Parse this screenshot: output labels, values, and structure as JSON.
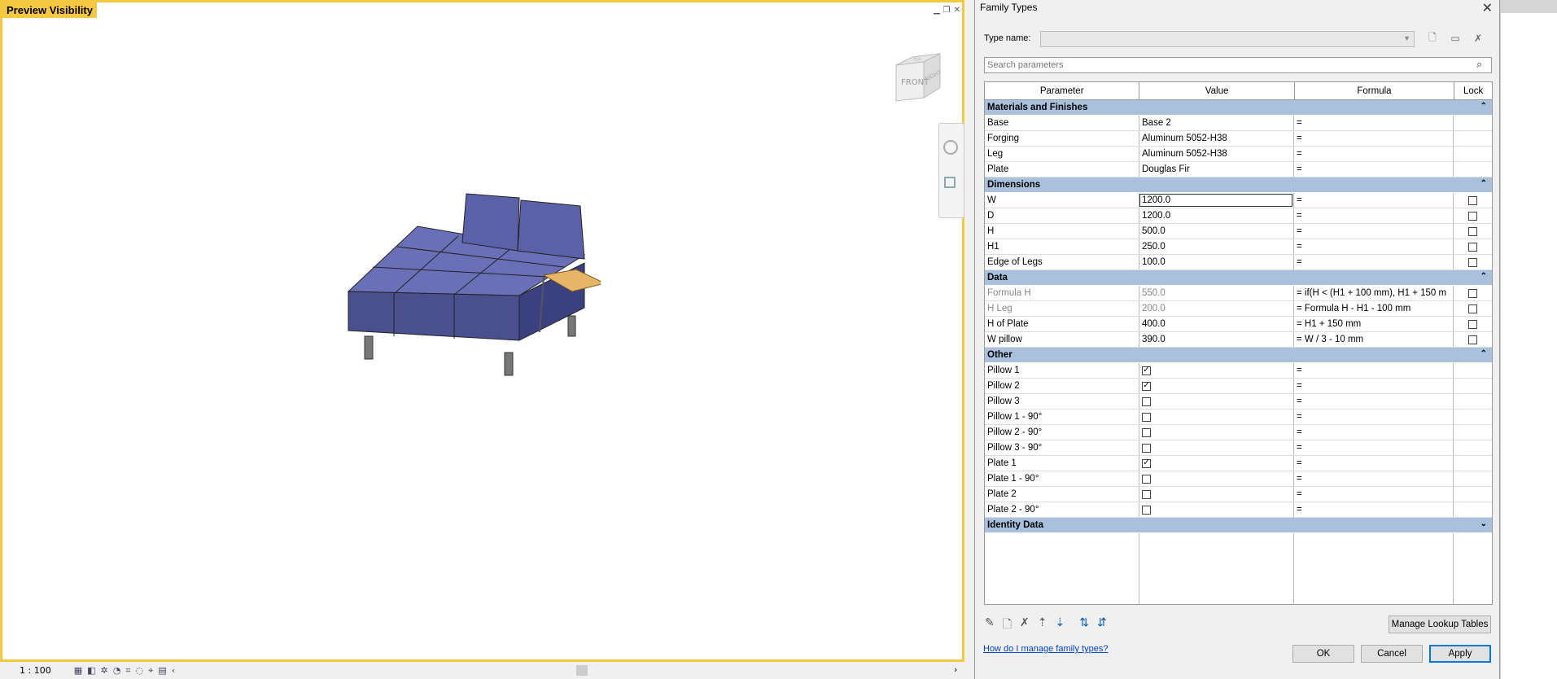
{
  "viewport": {
    "title": "Preview Visibility",
    "scale": "1 : 100",
    "viewcube_face": "FRONT",
    "viewcube_side": "RIGHT",
    "viewcube_top": "TOP"
  },
  "dialog": {
    "title": "Family Types",
    "type_name_label": "Type name:",
    "type_name_value": "",
    "search_placeholder": "Search parameters",
    "columns": [
      "Parameter",
      "Value",
      "Formula",
      "Lock"
    ],
    "groups": {
      "materials": {
        "name": "Materials and Finishes",
        "rows": [
          {
            "param": "Base",
            "value": "Base 2",
            "formula": "="
          },
          {
            "param": "Forging",
            "value": "Aluminum 5052-H38",
            "formula": "="
          },
          {
            "param": "Leg",
            "value": "Aluminum 5052-H38",
            "formula": "="
          },
          {
            "param": "Plate",
            "value": "Douglas Fir",
            "formula": "="
          }
        ]
      },
      "dimensions": {
        "name": "Dimensions",
        "rows": [
          {
            "param": "W",
            "value": "1200.0",
            "formula": "="
          },
          {
            "param": "D",
            "value": "1200.0",
            "formula": "="
          },
          {
            "param": "H",
            "value": "500.0",
            "formula": "="
          },
          {
            "param": "H1",
            "value": "250.0",
            "formula": "="
          },
          {
            "param": "Edge of Legs",
            "value": "100.0",
            "formula": "="
          }
        ]
      },
      "data": {
        "name": "Data",
        "rows": [
          {
            "param": "Formula H",
            "value": "550.0",
            "formula": "= if(H < (H1 + 100 mm), H1 + 150 m"
          },
          {
            "param": "H Leg",
            "value": "200.0",
            "formula": "= Formula H - H1 - 100 mm"
          },
          {
            "param": "H of Plate",
            "value": "400.0",
            "formula": "= H1 + 150 mm"
          },
          {
            "param": "W pillow",
            "value": "390.0",
            "formula": "= W / 3 - 10 mm"
          }
        ]
      },
      "other": {
        "name": "Other",
        "rows": [
          {
            "param": "Pillow 1",
            "checked": "✓",
            "formula": "="
          },
          {
            "param": "Pillow 2",
            "checked": "✓",
            "formula": "="
          },
          {
            "param": "Pillow 3",
            "checked": "",
            "formula": "="
          },
          {
            "param": "Pillow 1 - 90°",
            "checked": "",
            "formula": "="
          },
          {
            "param": "Pillow 2 - 90°",
            "checked": "",
            "formula": "="
          },
          {
            "param": "Pillow 3 - 90°",
            "checked": "",
            "formula": "="
          },
          {
            "param": "Plate 1",
            "checked": "✓",
            "formula": "="
          },
          {
            "param": "Plate 1 - 90°",
            "checked": "",
            "formula": "="
          },
          {
            "param": "Plate 2",
            "checked": "",
            "formula": "="
          },
          {
            "param": "Plate 2 - 90°",
            "checked": "",
            "formula": "="
          }
        ]
      },
      "identity": {
        "name": "Identity Data"
      }
    },
    "manage_lookup": "Manage Lookup Tables",
    "help_link": "How do I manage family types?",
    "ok": "OK",
    "cancel": "Cancel",
    "apply": "Apply"
  }
}
